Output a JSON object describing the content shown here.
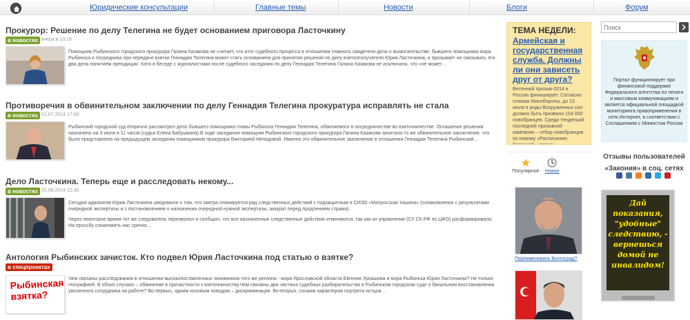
{
  "nav": {
    "items": [
      "Юридические консультации",
      "Главные темы",
      "Новости",
      "Блоги",
      "Форум"
    ]
  },
  "articles": [
    {
      "title": "Прокурор: Решение по делу Телегина не будет основанием приговора Ласточкину",
      "badge": "в новостях",
      "date": "вчера в 13:18",
      "text": "Помощник Рыбинского городского прокурора Галина Казакова не считает, что итог судебного процесса в отношении главного свидетеля дела о вымогательстве, бывшего помощника мэра Рыбинска и посредника при передаче взятки Геннадия Телегина может стать основанием для принятия решения по делу взяткополучателя Юрия Ласточкина, и призывает не связывать эти два дела понятием преюдиции. Хотя в беседе с журналистами после судебного заседания по делу Геннадия Телегина Галина Казакова не исключила, что «не может…"
    },
    {
      "title": "Противоречия в обвинительном заключении по делу Геннадия Телегина прокуратура исправлять не стала",
      "badge": "в новостях",
      "date": "01.07.2014 17:00",
      "text": "Рыбинский городской суд вторично рассмотрел дело бывшего помощника главы Рыбинска Геннадия Телегина, обвиняемого в посредничестве во взяточничестве. Оглашение решения назначено на 3 июля в 11 часов (судья Елена Бабушкина).В ходе заседания помощник Рыбинского городского прокурора Галина Казакова зачитала то же обвинительное заключение, что было представлено на предыдущем заседании помощником прокурора Викторией Нелидовой. Именно это обвинительное заключение в отношении Геннадия Телегина Рыбинский…"
    },
    {
      "title": "Дело Ласточкина. Теперь еще и расследовать некому...",
      "badge": "в новостях",
      "date": "20.06.2014 22:45",
      "text": "Сегодня адвокатов Юрия Ласточкина уведомили о том, что завтра планируется ряд следственных действий с подзащитным в СИЗО «Матросская тишина» (ознакомление с результатами очередной экспертизы и с постановлением о назначении очередной нужной экспертизы, аккурат перед продлением стражи).",
      "text2": "Через некоторое время тот же следователь перезвонил и сообщил, что все назначенные следственные действия отменяются, так как их управление (СУ СК РФ по ЦФО) расформировали. На просьбу ознакомить нас срочно…"
    },
    {
      "title": "Антология Рыбинских зачисток. Кто подвел Юрия Ласточкина под статью о взятке?",
      "badge": "в спецпроектах",
      "date": "",
      "thumb_text": "Рыбинская взятка?",
      "text": "Чем связаны расследования в отношении высокопоставленных чиновников того же региона - мэра Ярославской области Евгения Урлашова и мэра Рыбинска Юрия Ласточкина? Не только географией. В обоих случаях – обвинение в причастности к взяточничеству.Чем связаны два частных судебных разбирательства в Рыбинском городском суде о банальном восстановлении уволенного сотрудника на работе? Во-первых, одним исковым поводом – дискриминация. Во-вторых, схожим характером портрета истцов…"
    }
  ],
  "topic_week": {
    "label": "ТЕМА НЕДЕЛИ:",
    "link": "Армейская и государственная служба. Должны ли они зависеть друг от друга?",
    "text": "Весенний призыв-2014 в России финиширует. Согласно планам Минобороны, до 15 июля в ряды Вооруженных сил должно быть призвано 154 000 новобранцев. Среди тенденций последней призывной кампании – отбор новобранцев по новому «Расписанию болезней», персон…"
  },
  "mini_tabs": {
    "popular": "Популярное",
    "new": "Новое"
  },
  "person_caption": "Переименовать Волгоград?",
  "search": {
    "placeholder": "Поиск"
  },
  "gov_text": "Портал функционирует при финансовой поддержке Федерального агентства по печати и массовым коммуникациям и является официальной площадкой мониторинга правоприменения в сети Интернет, в соответствии с Соглашением с Минюстом России",
  "reviews_title": "Отзывы пользователей «Закония» в соц. сетях",
  "social_icons": [
    "facebook-icon",
    "vkontakte-icon",
    "odnoklassniki-icon",
    "livejournal-icon",
    "twitter-icon",
    "youtube-icon"
  ],
  "social_colors": [
    "#3b5998",
    "#4c75a3",
    "#f58220",
    "#2d6e9e",
    "#29a9e1",
    "#cc2020"
  ],
  "promo_text": "Дай показания, \"удобные\" следствию, - вернешься домой не инвалидом!",
  "colors": {
    "link": "#2a5db0",
    "badge_green": "#7aa02c",
    "badge_red": "#cc2200",
    "week_bg": "#fbe7a6",
    "gov_bg": "#e6f4fa"
  }
}
